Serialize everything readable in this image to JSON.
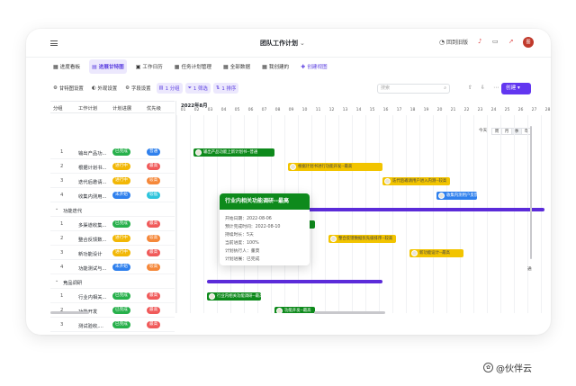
{
  "title": "团队工作计划",
  "header": {
    "back_label": "回到旧版",
    "avatar_text": "图"
  },
  "tabs": [
    {
      "label": "进度看板",
      "icon": "▦"
    },
    {
      "label": "进展甘特图",
      "icon": "▤",
      "active": true
    },
    {
      "label": "工作日历",
      "icon": "▣"
    },
    {
      "label": "任务计划管理",
      "icon": "▦"
    },
    {
      "label": "全部数据",
      "icon": "▦"
    },
    {
      "label": "我创建的",
      "icon": "▦"
    },
    {
      "label": "创建视图",
      "icon": "✚"
    }
  ],
  "toolbar": {
    "gantt_settings": "甘特图设置",
    "appearance": "外观设置",
    "fields": "字段设置",
    "group": "1 分组",
    "filter": "1 筛选",
    "sort": "1 排序",
    "search_placeholder": "搜索",
    "create": "创建"
  },
  "grid": {
    "columns": [
      "分组",
      "工作计划",
      "计划进展",
      "优先级"
    ],
    "rows": [
      {
        "kind": "task",
        "num": "1",
        "name": "输出产品功...",
        "status": "已完成",
        "status_color": "#27b04b",
        "priority": "普通",
        "priority_color": "#2f80ed"
      },
      {
        "kind": "task",
        "num": "2",
        "name": "根据计划书...",
        "status": "进行中",
        "status_color": "#f2b705",
        "priority": "最高",
        "priority_color": "#f05a5a"
      },
      {
        "kind": "task",
        "num": "3",
        "name": "迭代后邀请...",
        "status": "进行中",
        "status_color": "#f2b705",
        "priority": "较高",
        "priority_color": "#f5883a"
      },
      {
        "kind": "task",
        "num": "4",
        "name": "收集内测用...",
        "status": "未开始",
        "status_color": "#2f80ed",
        "priority": "较低",
        "priority_color": "#2ec4dc"
      },
      {
        "kind": "group",
        "name": "功能迭代"
      },
      {
        "kind": "task",
        "num": "1",
        "name": "多渠道收集...",
        "status": "已完成",
        "status_color": "#27b04b",
        "priority": "最高",
        "priority_color": "#f05a5a"
      },
      {
        "kind": "task",
        "num": "2",
        "name": "整合反馈数...",
        "status": "进行中",
        "status_color": "#f2b705",
        "priority": "较高",
        "priority_color": "#f5883a"
      },
      {
        "kind": "task",
        "num": "3",
        "name": "新功能设计",
        "status": "进行中",
        "status_color": "#f2b705",
        "priority": "最高",
        "priority_color": "#f05a5a"
      },
      {
        "kind": "task",
        "num": "4",
        "name": "功能测试与...",
        "status": "未开始",
        "status_color": "#2f80ed",
        "priority": "较高",
        "priority_color": "#f5883a"
      },
      {
        "kind": "group",
        "name": "竞品调研"
      },
      {
        "kind": "task",
        "num": "1",
        "name": "行业内相关...",
        "status": "已完成",
        "status_color": "#27b04b",
        "priority": "最高",
        "priority_color": "#f05a5a"
      },
      {
        "kind": "task",
        "num": "2",
        "name": "功能开发",
        "status": "已完成",
        "status_color": "#27b04b",
        "priority": "最高",
        "priority_color": "#f05a5a"
      },
      {
        "kind": "task",
        "num": "3",
        "name": "测试验收,...",
        "status": "已完成",
        "status_color": "#27b04b",
        "priority": "最高",
        "priority_color": "#f05a5a"
      }
    ]
  },
  "gantt": {
    "month": "2022年8月",
    "days": [
      "01",
      "02",
      "03",
      "04",
      "05",
      "06",
      "07",
      "08",
      "09",
      "10",
      "11",
      "12",
      "13",
      "14",
      "15",
      "16",
      "17",
      "18",
      "19",
      "20",
      "21",
      "22",
      "23",
      "24",
      "25",
      "26",
      "27",
      "28"
    ],
    "today_label": "今天",
    "view_modes": [
      {
        "label": "周"
      },
      {
        "label": "月"
      },
      {
        "label": "季",
        "on": true
      },
      {
        "label": "年"
      }
    ],
    "bars": [
      {
        "row": 0,
        "start": 2,
        "span": 6,
        "color": "green",
        "label": "输出产品功能上新计划书--普通"
      },
      {
        "row": 1,
        "start": 9,
        "span": 7,
        "color": "yellow",
        "label": "根据计划书进行功能开发--最高"
      },
      {
        "row": 2,
        "start": 16,
        "span": 5,
        "color": "yellow",
        "label": "迭代后邀请用户进入内测--较高"
      },
      {
        "row": 3,
        "start": 20,
        "span": 3,
        "color": "blue",
        "label": "收集内测用户反馈"
      },
      {
        "row": 4,
        "start": 5,
        "span": 23,
        "color": "purple",
        "label": ""
      },
      {
        "row": 5,
        "start": 5,
        "span": 6,
        "color": "green",
        "label": ""
      },
      {
        "row": 6,
        "start": 12,
        "span": 5,
        "color": "yellow",
        "label": "整合反馈数据优先级排序--较高"
      },
      {
        "row": 7,
        "start": 18,
        "span": 4,
        "color": "yellow",
        "label": "新功能设计--最高"
      },
      {
        "row": 9,
        "start": 3,
        "span": 13,
        "color": "purple",
        "label": ""
      },
      {
        "row": 10,
        "start": 3,
        "span": 4,
        "color": "green",
        "label": "行业内相关功能调研--最高"
      },
      {
        "row": 11,
        "start": 8,
        "span": 3,
        "color": "green",
        "label": "功能开发--最高"
      },
      {
        "row": 12,
        "start": 12,
        "span": 4,
        "color": "green",
        "label": "测试验收、修复漏洞--最高"
      }
    ],
    "tooltip": {
      "title": "行业内相关功能调研--最高",
      "lines": [
        "开始日期：2022-08-06",
        "预计完成时间：2022-08-10",
        "持续时长：5天",
        "当前进度：100%",
        "计划执行人：董莫",
        "计划进展：已完成"
      ]
    },
    "side_peek": "通"
  },
  "watermark": "@伙伴云"
}
